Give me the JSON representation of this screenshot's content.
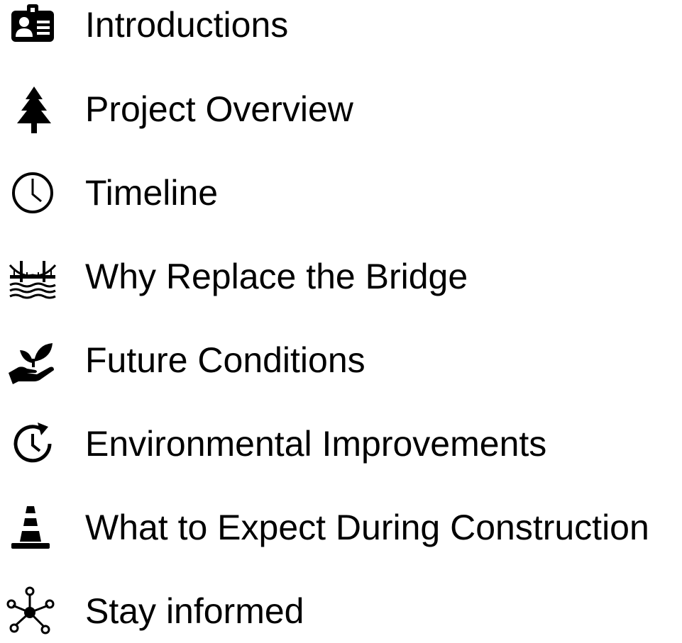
{
  "agenda": {
    "items": [
      {
        "icon": "id-badge-icon",
        "label": "Introductions"
      },
      {
        "icon": "tree-icon",
        "label": "Project Overview"
      },
      {
        "icon": "clock-icon",
        "label": "Timeline"
      },
      {
        "icon": "bridge-over-water-icon",
        "label": "Why Replace the Bridge"
      },
      {
        "icon": "seedling-in-hand-icon",
        "label": "Future Conditions"
      },
      {
        "icon": "clock-refresh-icon",
        "label": "Environmental Improvements"
      },
      {
        "icon": "traffic-cone-icon",
        "label": "What to Expect During Construction"
      },
      {
        "icon": "network-nodes-icon",
        "label": "Stay informed"
      }
    ]
  },
  "colors": {
    "text": "#000000",
    "background": "#ffffff"
  }
}
